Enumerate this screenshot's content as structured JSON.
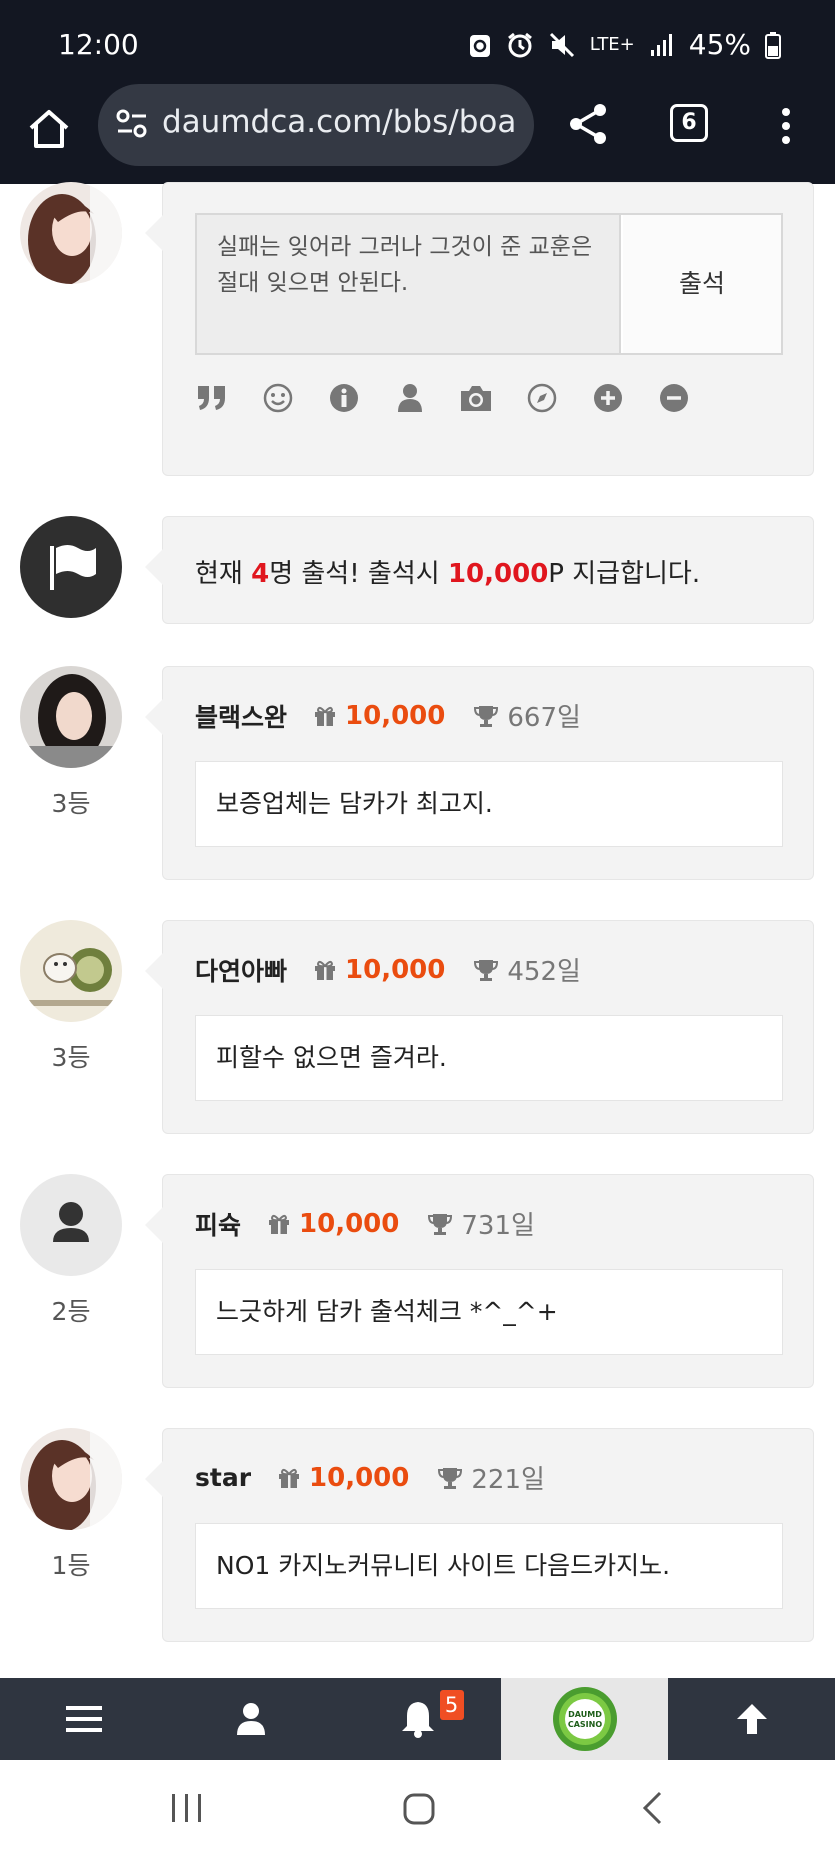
{
  "status_bar": {
    "time": "12:00",
    "network": "LTE+",
    "battery": "45%"
  },
  "browser": {
    "url": "daumdca.com/bbs/boa",
    "tab_count": "6"
  },
  "composer": {
    "text": "실패는 잊어라 그러나 그것이 준 교훈은 절대 잊으면 안된다.",
    "submit_label": "출석",
    "tools": [
      "quote-icon",
      "smile-icon",
      "info-icon",
      "user-icon",
      "camera-icon",
      "compass-icon",
      "plus-circle-icon",
      "minus-circle-icon"
    ]
  },
  "notice": {
    "prefix": "현재 ",
    "count": "4",
    "middle": "명 출석! 출석시 ",
    "points": "10,000",
    "suffix": "P 지급합니다."
  },
  "entries": [
    {
      "nick": "블랙스완",
      "points": "10,000",
      "days": "667일",
      "rank": "3등",
      "comment": "보증업체는 담카가 최고지."
    },
    {
      "nick": "다연아빠",
      "points": "10,000",
      "days": "452일",
      "rank": "3등",
      "comment": "피할수 없으면 즐겨라."
    },
    {
      "nick": "피슉",
      "points": "10,000",
      "days": "731일",
      "rank": "2등",
      "comment": "느긋하게 담카 출석체크 *^_^+"
    },
    {
      "nick": "star",
      "points": "10,000",
      "days": "221일",
      "rank": "1등",
      "comment": "NO1 카지노커뮤니티 사이트 다음드카지노."
    }
  ],
  "bottom_nav": {
    "notification_count": "5",
    "logo_text_1": "DAUMD",
    "logo_text_2": "CASINO"
  },
  "colors": {
    "highlight_red": "#e0161e",
    "points_orange": "#ea4c0f",
    "nav_bg": "#2f3540",
    "status_bg": "#131722"
  }
}
